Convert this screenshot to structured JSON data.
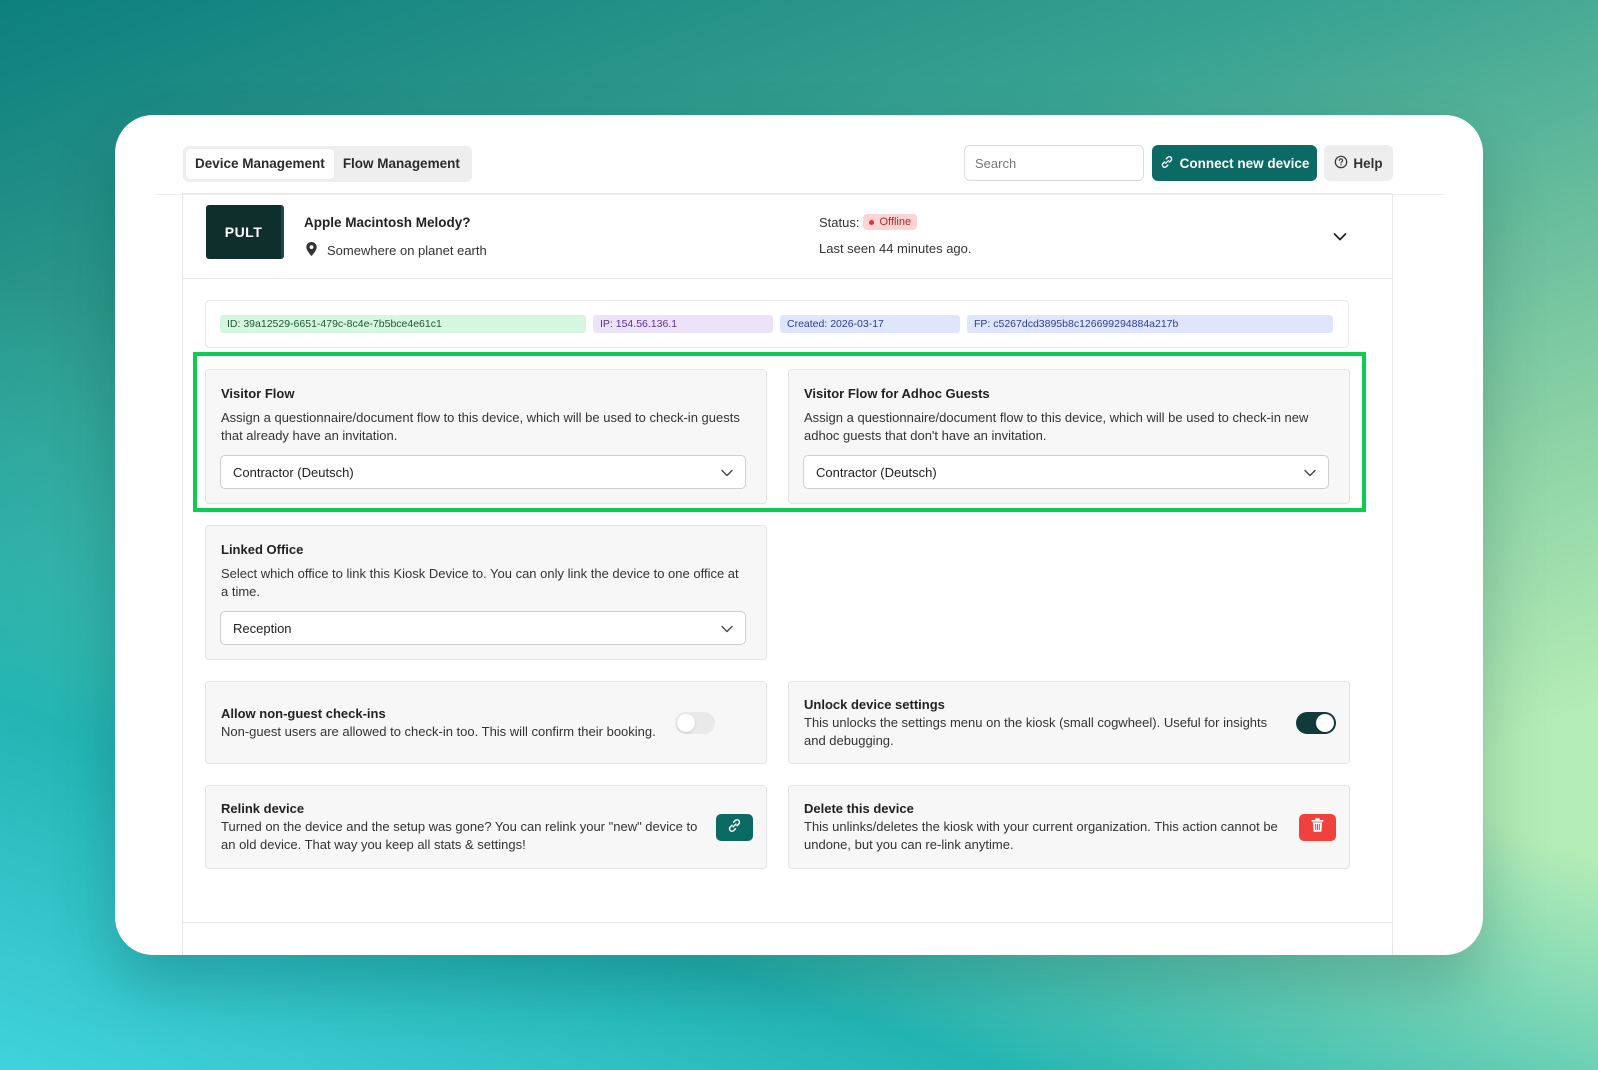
{
  "tabs": [
    {
      "label": "Device Management",
      "active": true
    },
    {
      "label": "Flow Management",
      "active": false
    }
  ],
  "search": {
    "placeholder": "Search",
    "icon": "search-icon"
  },
  "actions": {
    "connect_label": "Connect new device",
    "help_label": "Help"
  },
  "device": {
    "logo_text": "PULT",
    "name": "Apple Macintosh Melody?",
    "location": "Somewhere on planet earth",
    "status_label": "Status:",
    "status_value": "Offline",
    "last_seen": "Last seen 44 minutes ago."
  },
  "ids": {
    "id": "ID: 39a12529-6651-479c-8c4e-7b5bce4e61c1",
    "ip": "IP: 154.56.136.1",
    "created": "Created: 2026-03-17",
    "fp": "FP: c5267dcd3895b8c126699294884a217b"
  },
  "visitor_flow": {
    "title": "Visitor Flow",
    "desc": "Assign a questionnaire/document flow to this device, which will be used to check-in guests that already have an invitation.",
    "selected": "Contractor (Deutsch)"
  },
  "adhoc_flow": {
    "title": "Visitor Flow for Adhoc Guests",
    "desc": "Assign a questionnaire/document flow to this device, which will be used to check-in new adhoc guests that don't have an invitation.",
    "selected": "Contractor (Deutsch)"
  },
  "linked_office": {
    "title": "Linked Office",
    "desc": "Select which office to link this Kiosk Device to. You can only link the device to one office at a time.",
    "selected": "Reception"
  },
  "non_guest": {
    "title": "Allow non-guest check-ins",
    "desc": "Non-guest users are allowed to check-in too. This will confirm their booking.",
    "enabled": false
  },
  "unlock_settings": {
    "title": "Unlock device settings",
    "desc": "This unlocks the settings menu on the kiosk (small cogwheel). Useful for insights and debugging.",
    "enabled": true
  },
  "relink": {
    "title": "Relink device",
    "desc": "Turned on the device and the setup was gone? You can relink your \"new\" device to an old device. That way you keep all stats & settings!"
  },
  "delete": {
    "title": "Delete this device",
    "desc": "This unlinks/deletes the kiosk with your current organization. This action cannot be undone, but you can re-link anytime."
  },
  "colors": {
    "brand": "#0b6a64",
    "highlight": "#0ccd4f",
    "danger": "#f0413d",
    "offline_badge": "#fbd4d4"
  }
}
